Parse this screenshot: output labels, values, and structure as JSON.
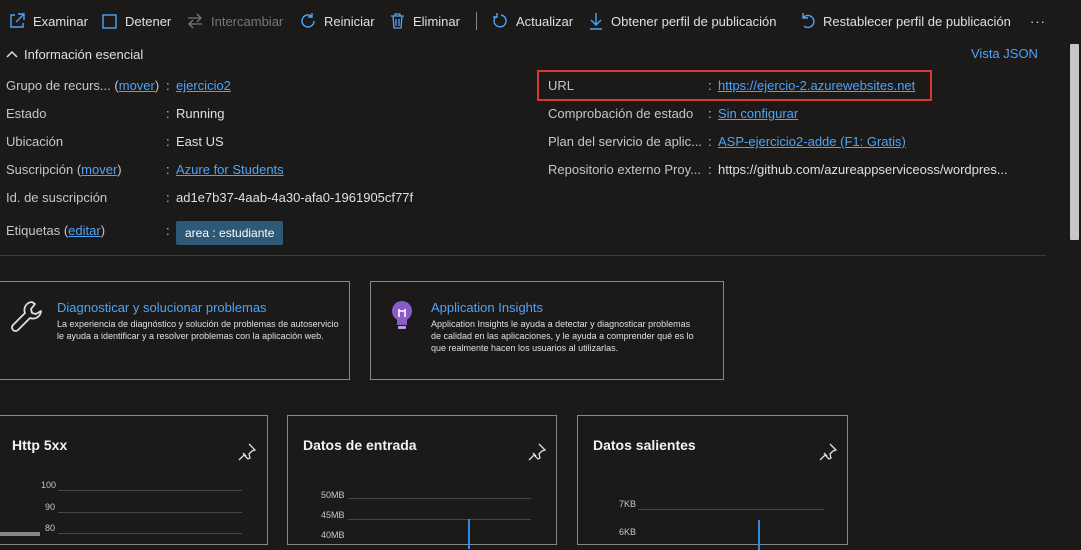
{
  "toolbar": {
    "browse": "Examinar",
    "stop": "Detener",
    "swap": "Intercambiar",
    "restart": "Reiniciar",
    "delete": "Eliminar",
    "refresh": "Actualizar",
    "get_profile": "Obtener perfil de publicación",
    "reset_profile": "Restablecer perfil de publicación",
    "more": "···"
  },
  "essentials": {
    "title": "Información esencial",
    "json_view": "Vista JSON",
    "left": {
      "resource_group_label": "Grupo de recurs...",
      "resource_group_move": "mover",
      "resource_group_value": "ejercicio2",
      "state_label": "Estado",
      "state_value": "Running",
      "location_label": "Ubicación",
      "location_value": "East US",
      "subscription_label": "Suscripción",
      "subscription_move": "mover",
      "subscription_value": "Azure for Students",
      "subscription_id_label": "Id. de suscripción",
      "subscription_id_value": "ad1e7b37-4aab-4a30-afa0-1961905cf77f",
      "tags_label": "Etiquetas",
      "tags_edit": "editar",
      "tag_value": "area : estudiante"
    },
    "right": {
      "url_label": "URL",
      "url_value": "https://ejercio-2.azurewebsites.net",
      "health_label": "Comprobación de estado",
      "health_value": "Sin configurar",
      "plan_label": "Plan del servicio de aplic...",
      "plan_value": "ASP-ejercicio2-adde (F1: Gratis)",
      "repo_label": "Repositorio externo Proy...",
      "repo_value": "https://github.com/azureappserviceoss/wordpres..."
    },
    "colon": ":"
  },
  "cards": [
    {
      "title": "Diagnosticar y solucionar problemas",
      "desc": "La experiencia de diagnóstico y solución de problemas de autoservicio le ayuda a identificar y a resolver problemas con la aplicación web."
    },
    {
      "title": "Application Insights",
      "desc": "Application Insights le ayuda a detectar y diagnosticar problemas de calidad en las aplicaciones, y le ayuda a comprender qué es lo que realmente hacen los usuarios al utilizarlas."
    }
  ],
  "chart_data": [
    {
      "type": "bar",
      "title": "Http 5xx",
      "y_ticks": [
        "100",
        "90",
        "80"
      ],
      "values": []
    },
    {
      "type": "bar",
      "title": "Datos de entrada",
      "y_ticks": [
        "50MB",
        "45MB",
        "40MB"
      ],
      "values": []
    },
    {
      "type": "bar",
      "title": "Datos salientes",
      "y_ticks": [
        "7KB",
        "6KB"
      ],
      "values": []
    }
  ],
  "colors": {
    "background": "#1b1a19",
    "link": "#4fa3f7",
    "highlight_border": "#d83838",
    "tag_bg": "#2d5877"
  }
}
